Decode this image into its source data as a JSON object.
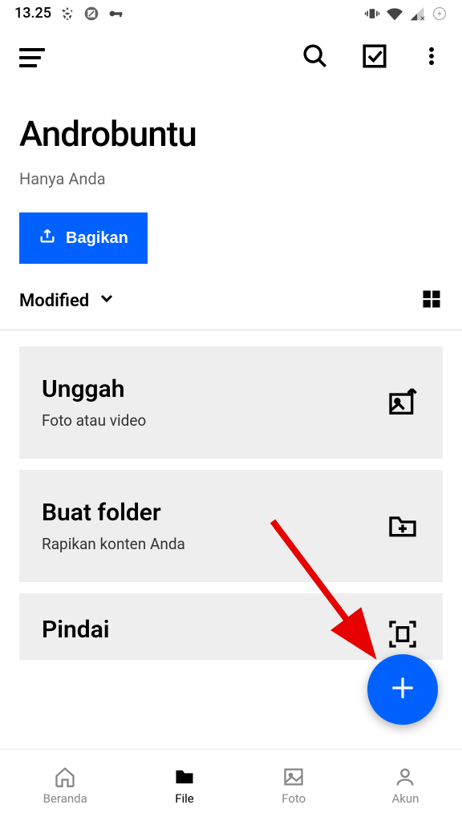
{
  "status": {
    "time": "13.25"
  },
  "header": {
    "title": "Androbuntu",
    "subtitle": "Hanya Anda",
    "share_label": "Bagikan"
  },
  "filter": {
    "sort_label": "Modified"
  },
  "actions": [
    {
      "title": "Unggah",
      "subtitle": "Foto atau video"
    },
    {
      "title": "Buat folder",
      "subtitle": "Rapikan konten Anda"
    },
    {
      "title": "Pindai",
      "subtitle": ""
    }
  ],
  "nav": {
    "home": "Beranda",
    "file": "File",
    "photo": "Foto",
    "account": "Akun"
  },
  "colors": {
    "primary": "#0061ff"
  }
}
